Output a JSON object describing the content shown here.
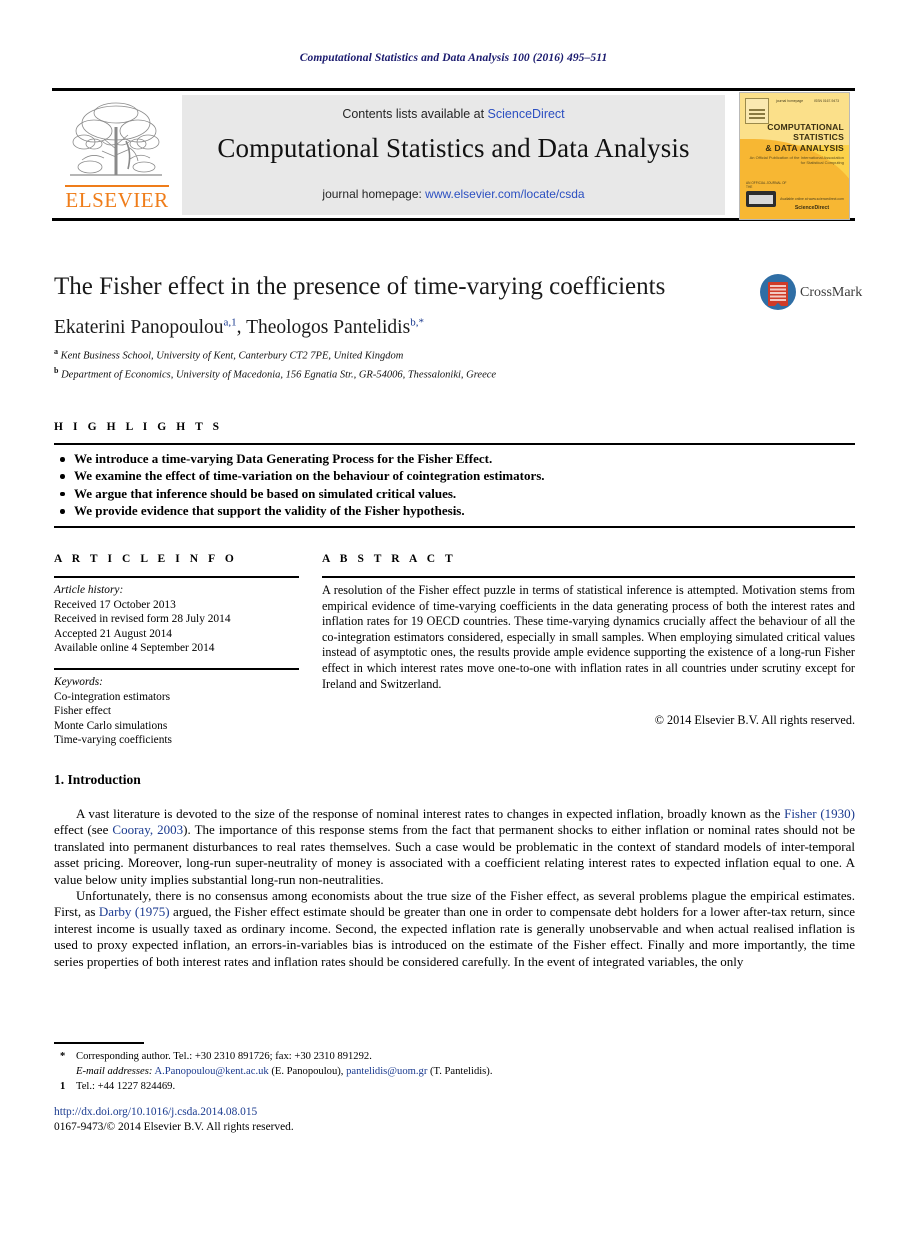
{
  "running_head": "Computational Statistics and Data Analysis 100 (2016) 495–511",
  "masthead": {
    "contents_prefix": "Contents lists available at ",
    "contents_link": "ScienceDirect",
    "journal_title": "Computational Statistics and Data Analysis",
    "homepage_prefix": "journal homepage: ",
    "homepage_link": "www.elsevier.com/locate/csda",
    "publisher_wordmark": "ELSEVIER",
    "cover": {
      "title_line1": "COMPUTATIONAL",
      "title_line2": "STATISTICS",
      "title_line3": "& DATA ANALYSIS",
      "subtitle": "An Official Publication of the International Association for Statistical Computing",
      "top_left_note": "journal homepage",
      "top_right_note": "ISSN 0167-9473",
      "badge_label": "AN OFFICIAL JOURNAL OF THE",
      "footer_brand": "ScienceDirect",
      "footer_note": "Available online at www.sciencedirect.com"
    }
  },
  "article": {
    "title": "The Fisher effect in the presence of time-varying coefficients",
    "crossmark_label": "CrossMark",
    "authors": [
      {
        "name": "Ekaterini Panopoulou",
        "sup": "a,1"
      },
      {
        "name": "Theologos Pantelidis",
        "sup": "b,*"
      }
    ],
    "affiliations": [
      {
        "mark": "a",
        "text": "Kent Business School, University of Kent, Canterbury CT2 7PE, United Kingdom"
      },
      {
        "mark": "b",
        "text": "Department of Economics, University of Macedonia, 156 Egnatia Str., GR-54006, Thessaloniki, Greece"
      }
    ]
  },
  "highlights": {
    "label": "H I G H L I G H T S",
    "items": [
      "We introduce a time-varying Data Generating Process for the Fisher Effect.",
      "We examine the effect of time-variation on the behaviour of cointegration estimators.",
      "We argue that inference should be based on simulated critical values.",
      "We provide evidence that support the validity of the Fisher hypothesis."
    ]
  },
  "article_info": {
    "label": "A R T I C L E    I N F O",
    "history_heading": "Article history:",
    "history": [
      "Received 17 October 2013",
      "Received in revised form 28 July 2014",
      "Accepted 21 August 2014",
      "Available online 4 September 2014"
    ],
    "keywords_heading": "Keywords:",
    "keywords": [
      "Co-integration estimators",
      "Fisher effect",
      "Monte Carlo simulations",
      "Time-varying coefficients"
    ]
  },
  "abstract": {
    "label": "A B S T R A C T",
    "text": "A resolution of the Fisher effect puzzle in terms of statistical inference is attempted. Motivation stems from empirical evidence of time-varying coefficients in the data generating process of both the interest rates and inflation rates for 19 OECD countries. These time-varying dynamics crucially affect the behaviour of all the co-integration estimators considered, especially in small samples. When employing simulated critical values instead of asymptotic ones, the results provide ample evidence supporting the existence of a long-run Fisher effect in which interest rates move one-to-one with inflation rates in all countries under scrutiny except for Ireland and Switzerland.",
    "copyright": "© 2014 Elsevier B.V. All rights reserved."
  },
  "introduction": {
    "heading": "1. Introduction",
    "para1_a": "A vast literature is devoted to the size of the response of nominal interest rates to changes in expected inflation, broadly known as the ",
    "para1_ref1": "Fisher (1930)",
    "para1_b": " effect (see ",
    "para1_ref2": "Cooray, 2003",
    "para1_c": "). The importance of this response stems from the fact that permanent shocks to either inflation or nominal rates should not be translated into permanent disturbances to real rates themselves. Such a case would be problematic in the context of standard models of inter-temporal asset pricing. Moreover, long-run super-neutrality of money is associated with a coefficient relating interest rates to expected inflation equal to one. A value below unity implies substantial long-run non-neutralities.",
    "para2_a": "Unfortunately, there is no consensus among economists about the true size of the Fisher effect, as several problems plague the empirical estimates. First, as ",
    "para2_ref1": "Darby (1975)",
    "para2_b": " argued, the Fisher effect estimate should be greater than one in order to compensate debt holders for a lower after-tax return, since interest income is usually taxed as ordinary income. Second, the expected inflation rate is generally unobservable and when actual realised inflation is used to proxy expected inflation, an errors-in-variables bias is introduced on the estimate of the Fisher effect. Finally and more importantly, the time series properties of both interest rates and inflation rates should be considered carefully. In the event of integrated variables, the only"
  },
  "footnotes": {
    "corresponding_mark": "*",
    "corresponding_text": "Corresponding author. Tel.: +30 2310 891726; fax: +30 2310 891292.",
    "email_label": "E-mail addresses:",
    "email1": "A.Panopoulou@kent.ac.uk",
    "email1_who": " (E. Panopoulou), ",
    "email2": "pantelidis@uom.gr",
    "email2_who": " (T. Pantelidis).",
    "note1_mark": "1",
    "note1_text": "Tel.: +44 1227 824469.",
    "doi": "http://dx.doi.org/10.1016/j.csda.2014.08.015",
    "issn_line": "0167-9473/© 2014 Elsevier B.V. All rights reserved."
  }
}
